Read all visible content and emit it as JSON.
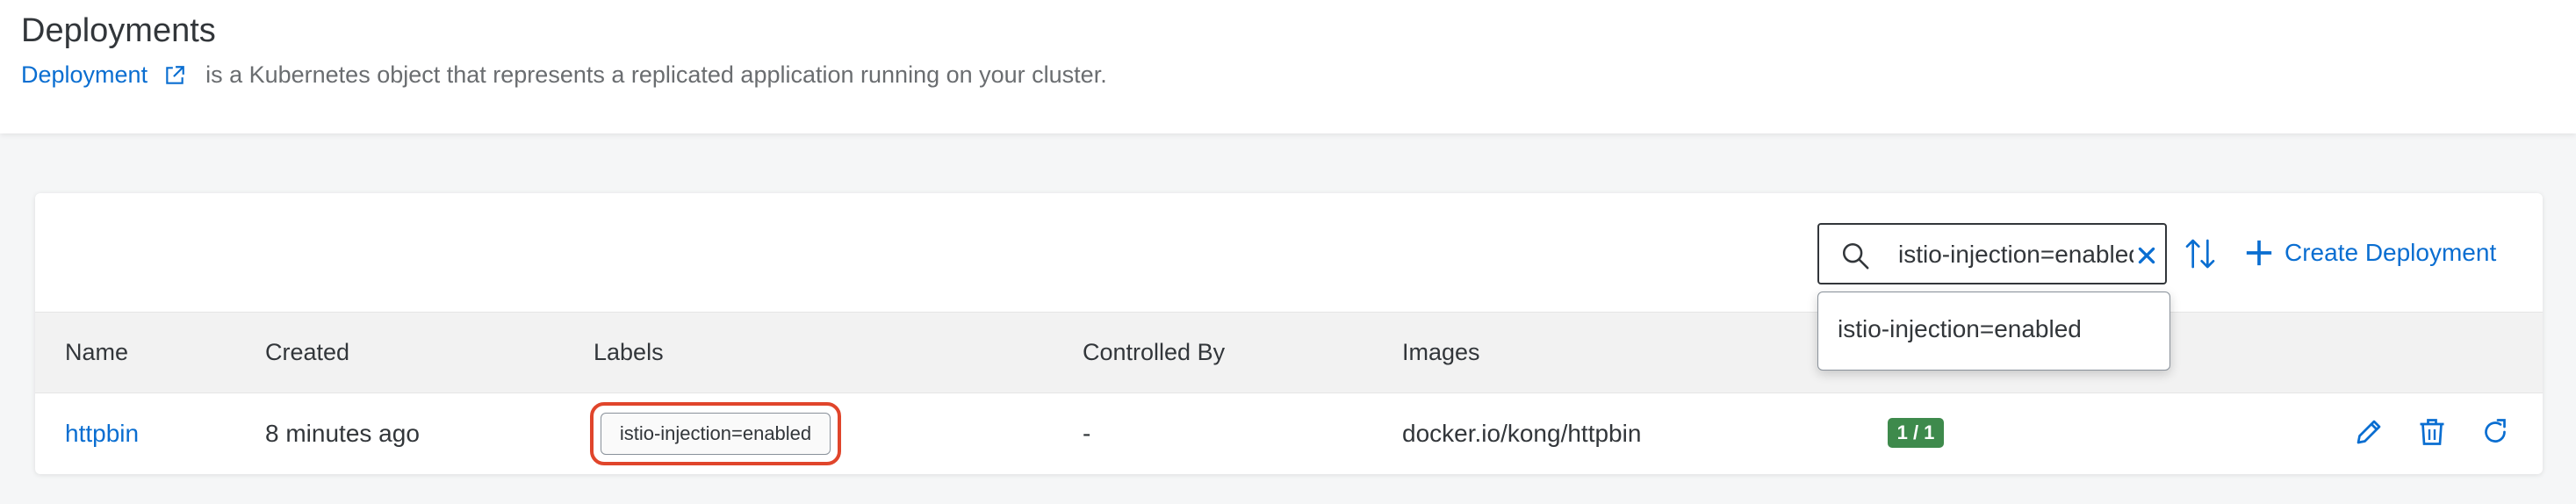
{
  "header": {
    "title": "Deployments",
    "doc_link": "Deployment",
    "description": "is a Kubernetes object that represents a replicated application running on your cluster."
  },
  "toolbar": {
    "search_value": "istio-injection=enabled",
    "create_label": "Create Deployment"
  },
  "suggestions": [
    "istio-injection=enabled"
  ],
  "table": {
    "columns": [
      "Name",
      "Created",
      "Labels",
      "Controlled By",
      "Images"
    ],
    "rows": [
      {
        "name": "httpbin",
        "created": "8 minutes ago",
        "label": "istio-injection=enabled",
        "controlled_by": "-",
        "image": "docker.io/kong/httpbin",
        "status": "1 / 1"
      }
    ]
  },
  "colors": {
    "accent": "#0a6ed1",
    "status_ok": "#3e8a4c",
    "highlight": "#e0452b"
  },
  "icons": {
    "external_link": "external-link-icon",
    "search": "search-icon",
    "clear": "clear-icon",
    "sort": "sort-icon",
    "create": "plus-icon",
    "edit": "edit-icon",
    "delete": "delete-icon",
    "restart": "restart-icon"
  }
}
